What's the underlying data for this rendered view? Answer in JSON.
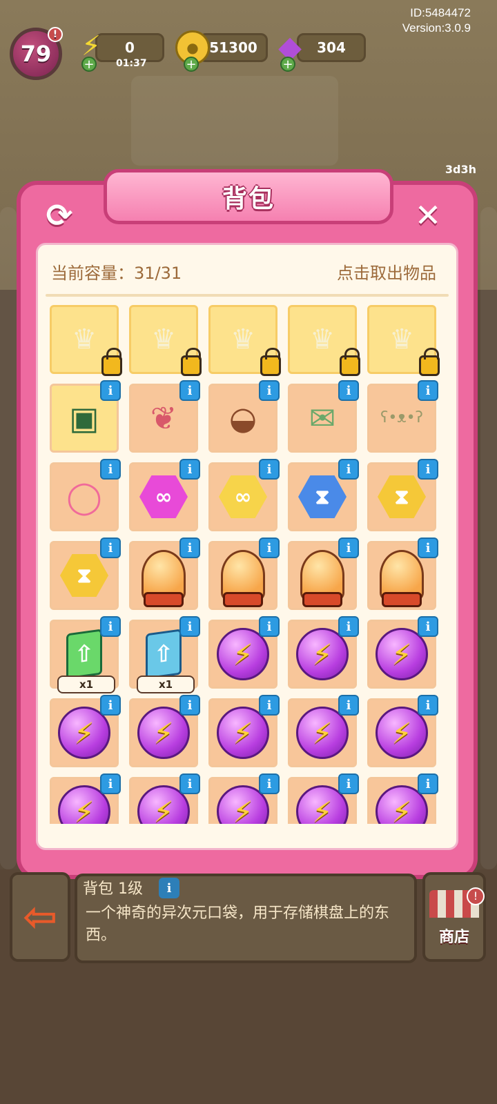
{
  "version": {
    "id": "ID:5484472",
    "version": "Version:3.0.9"
  },
  "hud": {
    "level": "79",
    "energy": "0",
    "energy_timer": "01:37",
    "coins": "51300",
    "gems": "304",
    "side_timer": "3d3h"
  },
  "panel": {
    "title": "背包",
    "capacity_label": "当前容量：",
    "capacity_value": "31/31",
    "hint": "点击取出物品"
  },
  "slots": [
    {
      "kind": "locked"
    },
    {
      "kind": "locked"
    },
    {
      "kind": "locked"
    },
    {
      "kind": "locked"
    },
    {
      "kind": "locked"
    },
    {
      "kind": "item",
      "icon": "toolbox-icon"
    },
    {
      "kind": "item",
      "icon": "map-book-icon"
    },
    {
      "kind": "item",
      "icon": "backpack-bag-icon"
    },
    {
      "kind": "item",
      "icon": "torn-envelope-icon"
    },
    {
      "kind": "item",
      "icon": "teddy-bear-icon"
    },
    {
      "kind": "item",
      "icon": "flamingo-float-icon"
    },
    {
      "kind": "item",
      "icon": "pink-infinity-hex-icon"
    },
    {
      "kind": "item",
      "icon": "gold-infinity-hex-icon"
    },
    {
      "kind": "item",
      "icon": "blue-hourglass-hex-icon"
    },
    {
      "kind": "item",
      "icon": "gold-hourglass-hex-icon"
    },
    {
      "kind": "item",
      "icon": "gold-hourglass-hex-icon"
    },
    {
      "kind": "item",
      "icon": "crystal-ball-machine-icon"
    },
    {
      "kind": "item",
      "icon": "crystal-ball-machine-icon"
    },
    {
      "kind": "item",
      "icon": "crystal-ball-machine-icon"
    },
    {
      "kind": "item",
      "icon": "crystal-ball-machine-icon"
    },
    {
      "kind": "item",
      "icon": "green-upgrade-card-icon",
      "count": "x1"
    },
    {
      "kind": "item",
      "icon": "blue-upgrade-card-icon",
      "count": "x1"
    },
    {
      "kind": "item",
      "icon": "energy-orb-icon"
    },
    {
      "kind": "item",
      "icon": "energy-orb-icon"
    },
    {
      "kind": "item",
      "icon": "energy-orb-icon"
    },
    {
      "kind": "item",
      "icon": "energy-orb-icon"
    },
    {
      "kind": "item",
      "icon": "energy-orb-icon"
    },
    {
      "kind": "item",
      "icon": "energy-orb-icon"
    },
    {
      "kind": "item",
      "icon": "energy-orb-icon"
    },
    {
      "kind": "item",
      "icon": "energy-orb-icon"
    },
    {
      "kind": "item",
      "icon": "energy-orb-icon"
    },
    {
      "kind": "item",
      "icon": "energy-orb-icon"
    },
    {
      "kind": "item",
      "icon": "energy-orb-icon"
    },
    {
      "kind": "item",
      "icon": "energy-orb-icon"
    },
    {
      "kind": "item",
      "icon": "energy-orb-icon"
    }
  ],
  "info": {
    "title": "背包 1级",
    "description": "一个神奇的异次元口袋，用于存储棋盘上的东西。"
  },
  "shop": {
    "label": "商店"
  },
  "colors": {
    "panel_pink": "#ee6aa0",
    "panel_border": "#c83f78",
    "slot_orange": "#f8c69a",
    "slot_locked": "#fde28c",
    "info_blue": "#2d9be2",
    "orb_purple": "#b83ee0"
  }
}
